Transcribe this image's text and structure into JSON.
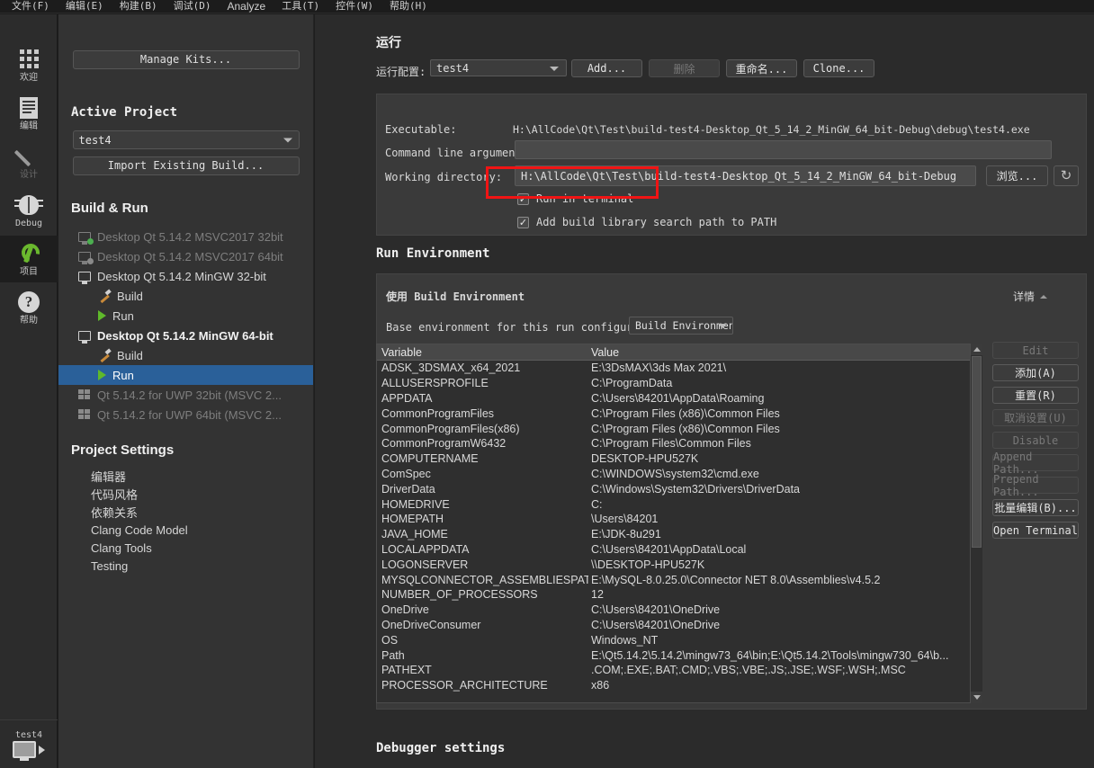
{
  "menubar": {
    "items": [
      {
        "label": "文件(F)"
      },
      {
        "label": "编辑(E)"
      },
      {
        "label": "构建(B)"
      },
      {
        "label": "调试(D)"
      },
      {
        "label": "Analyze"
      },
      {
        "label": "工具(T)"
      },
      {
        "label": "控件(W)"
      },
      {
        "label": "帮助(H)"
      }
    ]
  },
  "modebar": {
    "items": [
      {
        "label": "欢迎",
        "icon": "grid-icon"
      },
      {
        "label": "编辑",
        "icon": "document-icon"
      },
      {
        "label": "设计",
        "icon": "pencil-icon"
      },
      {
        "label": "Debug",
        "icon": "bug-icon"
      },
      {
        "label": "项目",
        "icon": "wrench-icon"
      },
      {
        "label": "帮助",
        "icon": "question-icon"
      }
    ],
    "kit_selector": {
      "project": "test4"
    }
  },
  "sidepanel": {
    "manage_kits": "Manage Kits...",
    "active_project_heading": "Active Project",
    "active_project_value": "test4",
    "import_existing_build": "Import Existing Build...",
    "build_run_heading": "Build & Run",
    "kits": [
      {
        "label": "Desktop Qt 5.14.2 MSVC2017 32bit",
        "icon": "monitor-plus-icon",
        "state": "dim"
      },
      {
        "label": "Desktop Qt 5.14.2 MSVC2017 64bit",
        "icon": "monitor-warn-icon",
        "state": "dim"
      },
      {
        "label": "Desktop Qt 5.14.2 MinGW 32-bit",
        "icon": "monitor-icon",
        "state": "normal"
      },
      {
        "label": "Build",
        "icon": "hammer-icon",
        "state": "child"
      },
      {
        "label": "Run",
        "icon": "play-icon",
        "state": "child"
      },
      {
        "label": "Desktop Qt 5.14.2 MinGW 64-bit",
        "icon": "monitor-icon",
        "state": "bold"
      },
      {
        "label": "Build",
        "icon": "hammer-icon",
        "state": "child"
      },
      {
        "label": "Run",
        "icon": "play-icon",
        "state": "child-selected"
      },
      {
        "label": "Qt 5.14.2 for UWP 32bit (MSVC 2...",
        "icon": "uwp-icon",
        "state": "dim"
      },
      {
        "label": "Qt 5.14.2 for UWP 64bit (MSVC 2...",
        "icon": "uwp-icon",
        "state": "dim"
      }
    ],
    "project_settings_heading": "Project Settings",
    "project_settings": [
      {
        "label": "编辑器"
      },
      {
        "label": "代码风格"
      },
      {
        "label": "依赖关系"
      },
      {
        "label": "Clang Code Model"
      },
      {
        "label": "Clang Tools"
      },
      {
        "label": "Testing"
      }
    ]
  },
  "run_section": {
    "title": "运行",
    "config_label": "运行配置:",
    "config_value": "test4",
    "buttons": [
      {
        "label": "Add...",
        "disabled": false
      },
      {
        "label": "删除",
        "disabled": true
      },
      {
        "label": "重命名...",
        "disabled": false
      },
      {
        "label": "Clone...",
        "disabled": false
      }
    ],
    "executable_label": "Executable:",
    "executable_value": "H:\\AllCode\\Qt\\Test\\build-test4-Desktop_Qt_5_14_2_MinGW_64_bit-Debug\\debug\\test4.exe",
    "cmdline_label": "Command line arguments:",
    "cmdline_value": "",
    "workdir_label": "Working directory:",
    "workdir_value": "H:\\AllCode\\Qt\\Test\\build-test4-Desktop_Qt_5_14_2_MinGW_64_bit-Debug",
    "browse_label": "浏览...",
    "reset_icon": "reset-icon",
    "run_in_terminal": {
      "label": "Run in terminal",
      "checked": true
    },
    "add_build_lib_path": {
      "label": "Add build library search path to PATH",
      "checked": true
    },
    "highlight_color": "#f01414"
  },
  "run_environment": {
    "title": "Run Environment",
    "use_label": "使用 Build Environment",
    "details_label": "详情",
    "base_env_label": "Base environment for this run configuration:",
    "base_env_value": "Build Environment",
    "columns": [
      "Variable",
      "Value"
    ],
    "rows": [
      [
        "ADSK_3DSMAX_x64_2021",
        "E:\\3DsMAX\\3ds Max 2021\\"
      ],
      [
        "ALLUSERSPROFILE",
        "C:\\ProgramData"
      ],
      [
        "APPDATA",
        "C:\\Users\\84201\\AppData\\Roaming"
      ],
      [
        "CommonProgramFiles",
        "C:\\Program Files (x86)\\Common Files"
      ],
      [
        "CommonProgramFiles(x86)",
        "C:\\Program Files (x86)\\Common Files"
      ],
      [
        "CommonProgramW6432",
        "C:\\Program Files\\Common Files"
      ],
      [
        "COMPUTERNAME",
        "DESKTOP-HPU527K"
      ],
      [
        "ComSpec",
        "C:\\WINDOWS\\system32\\cmd.exe"
      ],
      [
        "DriverData",
        "C:\\Windows\\System32\\Drivers\\DriverData"
      ],
      [
        "HOMEDRIVE",
        "C:"
      ],
      [
        "HOMEPATH",
        "\\Users\\84201"
      ],
      [
        "JAVA_HOME",
        "E:\\JDK-8u291"
      ],
      [
        "LOCALAPPDATA",
        "C:\\Users\\84201\\AppData\\Local"
      ],
      [
        "LOGONSERVER",
        "\\\\DESKTOP-HPU527K"
      ],
      [
        "MYSQLCONNECTOR_ASSEMBLIESPATH",
        "E:\\MySQL-8.0.25.0\\Connector NET 8.0\\Assemblies\\v4.5.2"
      ],
      [
        "NUMBER_OF_PROCESSORS",
        "12"
      ],
      [
        "OneDrive",
        "C:\\Users\\84201\\OneDrive"
      ],
      [
        "OneDriveConsumer",
        "C:\\Users\\84201\\OneDrive"
      ],
      [
        "OS",
        "Windows_NT"
      ],
      [
        "Path",
        "E:\\Qt5.14.2\\5.14.2\\mingw73_64\\bin;E:\\Qt5.14.2\\Tools\\mingw730_64\\b..."
      ],
      [
        "PATHEXT",
        ".COM;.EXE;.BAT;.CMD;.VBS;.VBE;.JS;.JSE;.WSF;.WSH;.MSC"
      ],
      [
        "PROCESSOR_ARCHITECTURE",
        "x86"
      ]
    ],
    "side_buttons": [
      {
        "label": "Edit",
        "disabled": true
      },
      {
        "label": "添加(A)",
        "disabled": false
      },
      {
        "label": "重置(R)",
        "disabled": false
      },
      {
        "label": "取消设置(U)",
        "disabled": true
      },
      {
        "label": "Disable",
        "disabled": true
      },
      {
        "label": "Append Path...",
        "disabled": true
      },
      {
        "label": "Prepend Path...",
        "disabled": true
      },
      {
        "label": "批量编辑(B)...",
        "disabled": false
      },
      {
        "label": "Open Terminal",
        "disabled": false
      }
    ]
  },
  "debugger_section": {
    "title": "Debugger settings"
  }
}
